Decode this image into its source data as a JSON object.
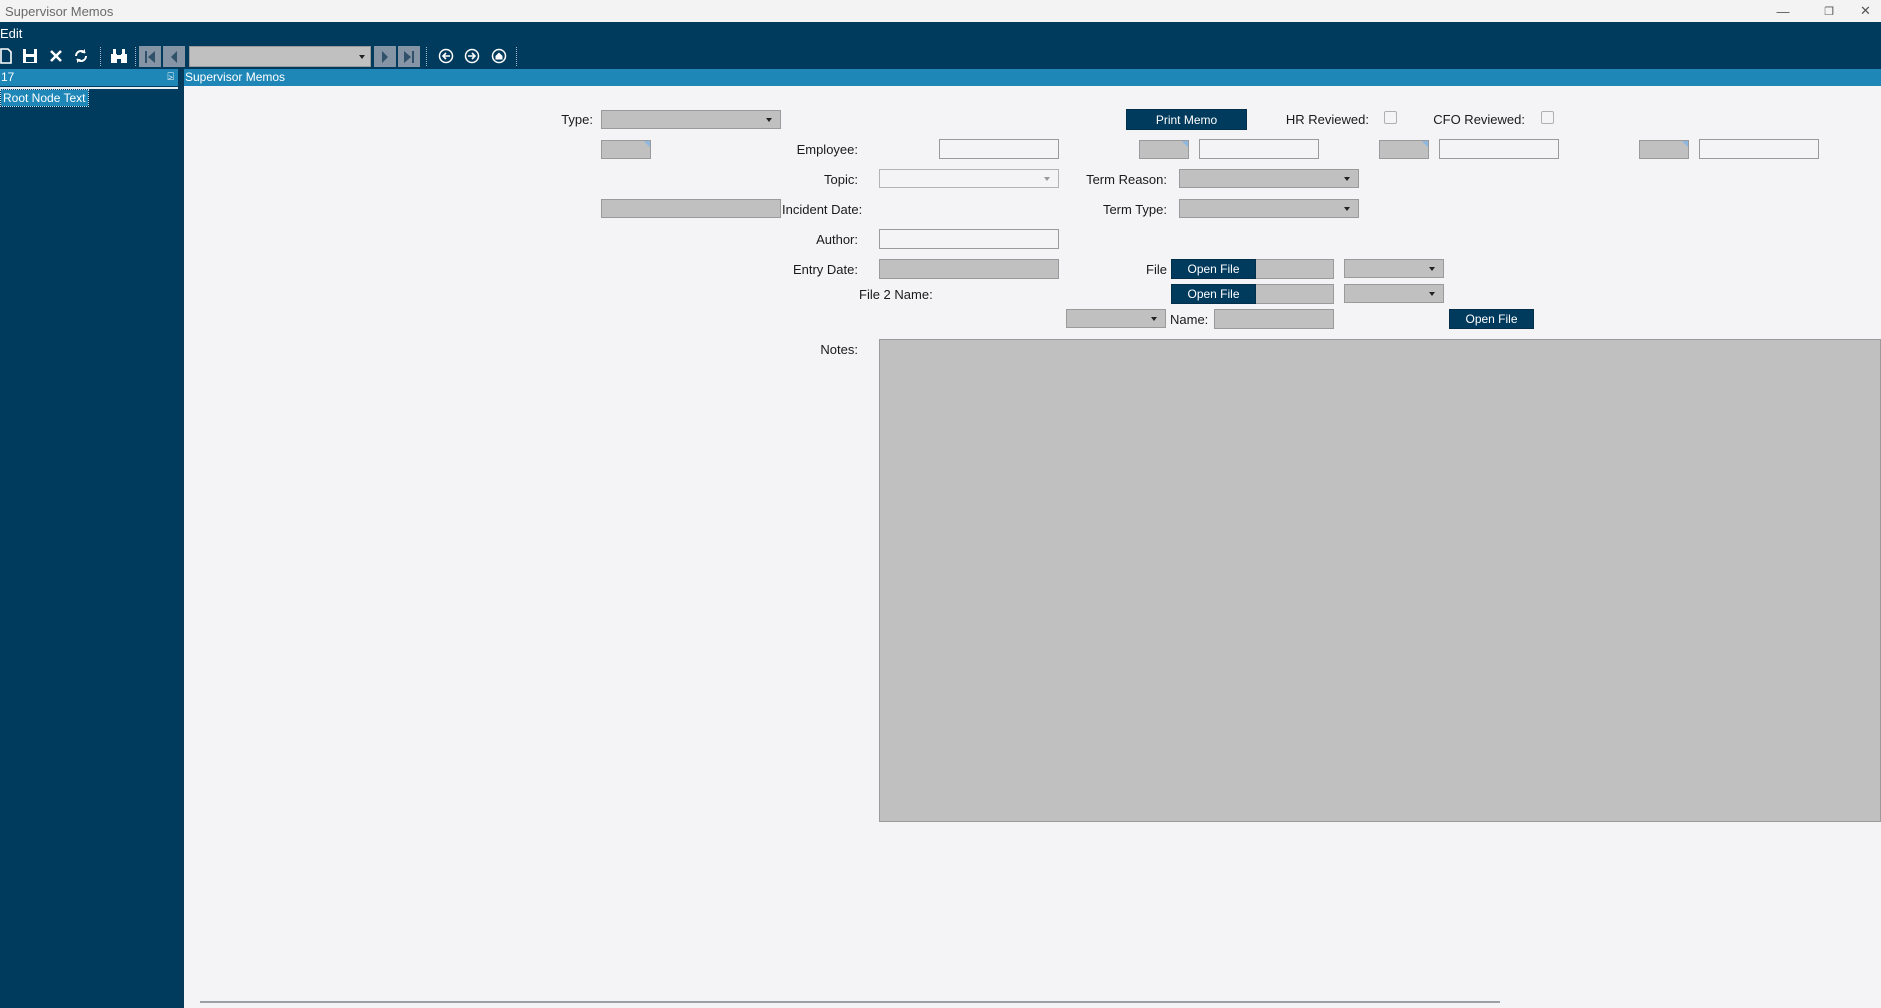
{
  "window": {
    "title": "Supervisor Memos",
    "minimize": "—",
    "restore": "❐",
    "close": "✕"
  },
  "menu": {
    "edit": "Edit"
  },
  "toolbar": {
    "icons": [
      "new-document-icon",
      "save-icon",
      "delete-icon",
      "refresh-icon",
      "binoculars-find-icon",
      "first-record-icon",
      "previous-record-icon",
      "next-record-icon",
      "last-record-icon",
      "back-icon",
      "forward-icon",
      "home-icon"
    ],
    "record_combo_value": ""
  },
  "left_pane": {
    "header": "17",
    "pin": "⍄",
    "root_node": "Root Node Text"
  },
  "main": {
    "header": "Supervisor Memos"
  },
  "form": {
    "type_label": "Type:",
    "print_memo": "Print Memo",
    "hr_reviewed_label": "HR Reviewed:",
    "cfo_reviewed_label": "CFO Reviewed:",
    "employee_label": "Employee:",
    "topic_label": "Topic:",
    "term_reason_label": "Term Reason:",
    "incident_date_label": "Incident Date:",
    "term_type_label": "Term Type:",
    "author_label": "Author:",
    "entry_date_label": "Entry Date:",
    "file_label": "File",
    "open_file_1": "Open File",
    "file2_name_label": "File 2 Name:",
    "open_file_2": "Open File",
    "name_label": "Name:",
    "open_file_3": "Open File",
    "notes_label": "Notes:"
  },
  "colors": {
    "dark_blue": "#003a5c",
    "header_blue": "#1f87b8",
    "field_gray": "#c0c0c0",
    "background": "#f4f4f6"
  }
}
